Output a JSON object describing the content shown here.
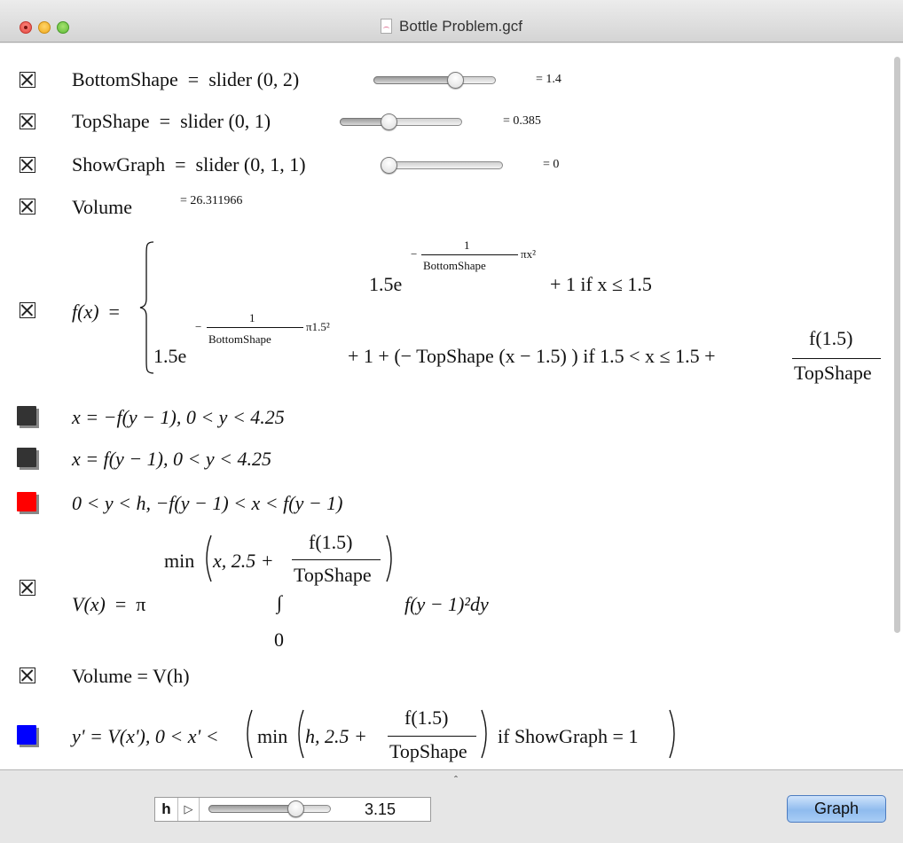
{
  "window": {
    "title": "Bottle Problem.gcf",
    "title_icon": "document-icon"
  },
  "rows": {
    "bottom_shape": {
      "lhs": "BottomShape",
      "eq": "=",
      "rhs": "slider (0, 2)",
      "value_text": "= 1.4",
      "slider_fraction": 0.7
    },
    "top_shape": {
      "lhs": "TopShape",
      "eq": "=",
      "rhs": "slider (0, 1)",
      "value_text": "= 0.385",
      "slider_fraction": 0.385
    },
    "show_graph": {
      "lhs": "ShowGraph",
      "eq": "=",
      "rhs": "slider (0, 1, 1)",
      "value_text": "= 0",
      "slider_fraction": 0
    },
    "volume_value": {
      "lhs": "Volume",
      "value_text": "= 26.311966"
    },
    "f_def": {
      "lhs": "f(x)",
      "eq": "=",
      "case1_coef": "1.5e",
      "case1_exp_minus": "−",
      "case1_exp_num": "1",
      "case1_exp_den": "BottomShape",
      "case1_exp_tail": "πx²",
      "case1_tail": "+ 1 if x ≤ 1.5",
      "case2_coef": "1.5e",
      "case2_exp_minus": "−",
      "case2_exp_num": "1",
      "case2_exp_den": "BottomShape",
      "case2_exp_tail": "π1.5²",
      "case2_tail": "+ 1 + (− TopShape (x − 1.5) ) if 1.5 < x ≤ 1.5 +",
      "case2_frac_num": "f(1.5)",
      "case2_frac_den": "TopShape"
    },
    "curve_left": {
      "text": "x = −f(y − 1), 0 < y < 4.25",
      "color": "#333333"
    },
    "curve_right": {
      "text": "x = f(y − 1), 0 < y < 4.25",
      "color": "#333333"
    },
    "region": {
      "text": "0 < y < h, −f(y − 1) < x < f(y − 1)",
      "color": "#ff0000"
    },
    "v_def": {
      "lhs": "V(x)",
      "eq": "=",
      "pi": "π",
      "upper_min": "min",
      "upper_args": "x, 2.5 +",
      "upper_frac_num": "f(1.5)",
      "upper_frac_den": "TopShape",
      "integral": "∫",
      "integrand": "f(y − 1)²dy",
      "lower": "0"
    },
    "volume_def": {
      "text": "Volume = V(h)"
    },
    "graph_def": {
      "text_a": "y' = V(x'), 0 < x' <",
      "text_min": "min",
      "text_args": "h, 2.5 +",
      "frac_num": "f(1.5)",
      "frac_den": "TopShape",
      "text_tail": "if ShowGraph = 1",
      "color": "#0000ff"
    }
  },
  "bottom": {
    "variable": "h",
    "play_icon": "play-icon",
    "value": "3.15",
    "slider_fraction": 0.75,
    "graph_button": "Graph",
    "splitter_glyph": "ˆ"
  }
}
